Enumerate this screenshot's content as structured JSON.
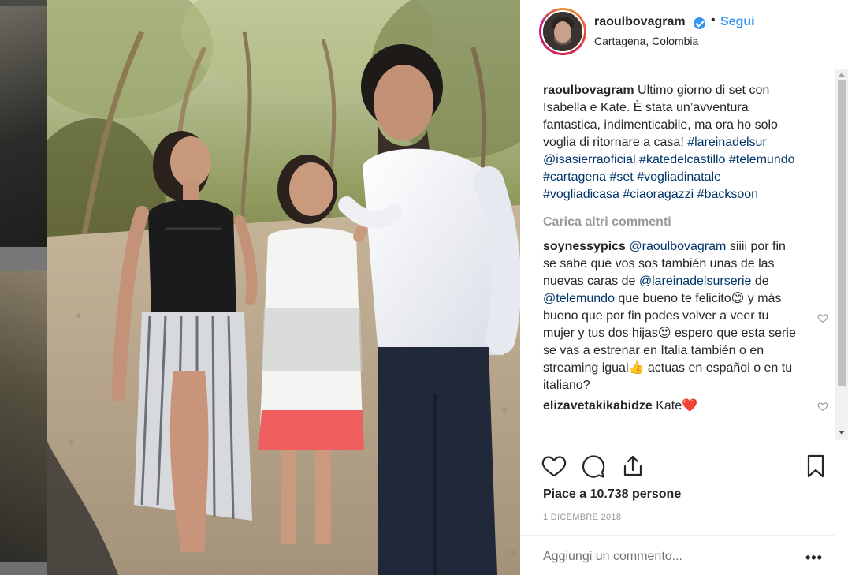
{
  "post": {
    "username": "raoulbovagram",
    "follow_label": "Segui",
    "separator": "•",
    "location": "Cartagena, Colombia",
    "caption": {
      "username": "raoulbovagram",
      "text": "Ultimo giorno di set con Isabella e Kate. È stata un’avventura fantastica, indimenticabile, ma ora ho solo voglia di ritornare a casa!",
      "hashtags": "#lareinadelsur @isasierraoficial #katedelcastillo #telemundo #cartagena #set #vogliadinatale #vogliadicasa #ciaoragazzi #backsoon"
    },
    "load_more_label": "Carica altri commenti",
    "comments": [
      {
        "username": "soynessypics",
        "mention1": "@raoulbovagram",
        "text1": " siiii por fin se sabe que vos sos también unas de las nuevas caras de ",
        "mention2": "@lareinadelsurserie",
        "text2": " de ",
        "mention3": "@telemundo",
        "text3": " que bueno te felicito😊 y más bueno que por fin podes volver a veer tu mujer y tus dos hijas😍 espero que esta serie se vas a estrenar en Italia también o en streaming igual👍 actuas en español o en tu italiano?"
      },
      {
        "username": "elizavetakikabidze",
        "text": " Kate❤️"
      }
    ],
    "likes_label": "Piace a 10.738 persone",
    "date": "1 DICEMBRE 2018",
    "add_comment_placeholder": "Aggiungi un commento...",
    "more_options": "•••"
  },
  "icons": {
    "like": "heart-icon",
    "comment": "comment-icon",
    "share": "share-icon",
    "save": "bookmark-icon",
    "verified": "verified-badge-icon"
  },
  "colors": {
    "link": "#3897f0",
    "hashtag": "#003569",
    "muted": "#999999",
    "text": "#262626"
  }
}
